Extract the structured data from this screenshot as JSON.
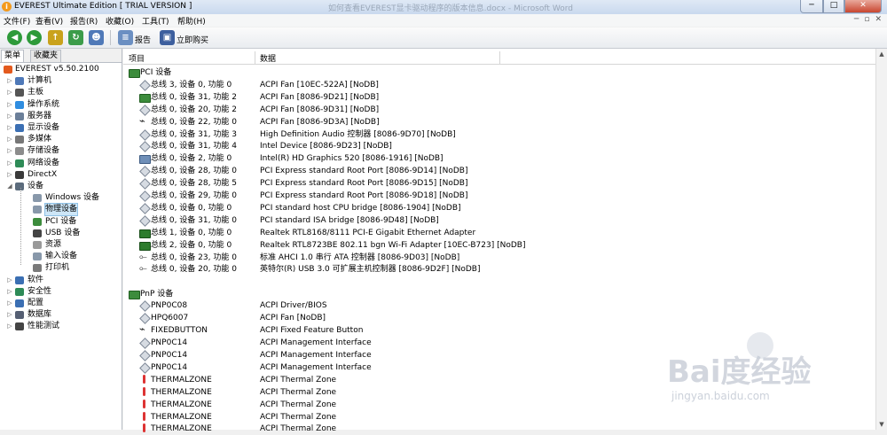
{
  "window": {
    "title": "EVEREST Ultimate Edition  [ TRIAL VERSION ]",
    "background_title": "如何查看EVEREST显卡驱动程序的版本信息.docx - Microsoft Word",
    "controls": {
      "minimize": "─",
      "maximize": "□",
      "close": "✕"
    }
  },
  "menu": {
    "items": [
      "文件(F)",
      "查看(V)",
      "报告(R)",
      "收藏(O)",
      "工具(T)",
      "帮助(H)"
    ],
    "mdi": [
      "─",
      "▫",
      "✕"
    ]
  },
  "toolbar": {
    "report_label": "报告",
    "buy_label": "立即购买"
  },
  "sidebar": {
    "tabs": [
      "菜单",
      "收藏夹"
    ],
    "items": [
      {
        "label": "EVEREST v5.50.2100",
        "level": 0,
        "arrow": "",
        "icon": "everest-icon",
        "color": "#e35a1e"
      },
      {
        "label": "计算机",
        "level": 1,
        "arrow": "▷",
        "icon": "computer-icon",
        "color": "#4f79b8"
      },
      {
        "label": "主板",
        "level": 1,
        "arrow": "▷",
        "icon": "motherboard-icon",
        "color": "#555555"
      },
      {
        "label": "操作系统",
        "level": 1,
        "arrow": "▷",
        "icon": "windows-icon",
        "color": "#2f8de0"
      },
      {
        "label": "服务器",
        "level": 1,
        "arrow": "▷",
        "icon": "server-icon",
        "color": "#6b7f99"
      },
      {
        "label": "显示设备",
        "level": 1,
        "arrow": "▷",
        "icon": "display-icon",
        "color": "#3b6fb3"
      },
      {
        "label": "多媒体",
        "level": 1,
        "arrow": "▷",
        "icon": "multimedia-icon",
        "color": "#777777"
      },
      {
        "label": "存储设备",
        "level": 1,
        "arrow": "▷",
        "icon": "storage-icon",
        "color": "#8c8c8c"
      },
      {
        "label": "网络设备",
        "level": 1,
        "arrow": "▷",
        "icon": "network-icon",
        "color": "#2e8b57"
      },
      {
        "label": "DirectX",
        "level": 1,
        "arrow": "▷",
        "icon": "directx-icon",
        "color": "#3a3a3a"
      },
      {
        "label": "设备",
        "level": 1,
        "arrow": "◢",
        "icon": "devices-icon",
        "color": "#5b6b7c"
      },
      {
        "label": "Windows 设备",
        "level": 2,
        "arrow": "",
        "icon": "windows-device-icon",
        "color": "#8898aa"
      },
      {
        "label": "物理设备",
        "level": 2,
        "arrow": "",
        "icon": "physical-device-icon",
        "color": "#8898aa"
      },
      {
        "label": "PCI 设备",
        "level": 2,
        "arrow": "",
        "icon": "pci-icon",
        "color": "#3c8c3c"
      },
      {
        "label": "USB 设备",
        "level": 2,
        "arrow": "",
        "icon": "usb-icon",
        "color": "#444444"
      },
      {
        "label": "资源",
        "level": 2,
        "arrow": "",
        "icon": "resources-icon",
        "color": "#9a9a9a"
      },
      {
        "label": "输入设备",
        "level": 2,
        "arrow": "",
        "icon": "input-icon",
        "color": "#8898aa"
      },
      {
        "label": "打印机",
        "level": 2,
        "arrow": "",
        "icon": "printer-icon",
        "color": "#7a7a7a"
      },
      {
        "label": "软件",
        "level": 1,
        "arrow": "▷",
        "icon": "software-icon",
        "color": "#3b6fb3"
      },
      {
        "label": "安全性",
        "level": 1,
        "arrow": "▷",
        "icon": "security-icon",
        "color": "#2e8b57"
      },
      {
        "label": "配置",
        "level": 1,
        "arrow": "▷",
        "icon": "config-icon",
        "color": "#3b6fb3"
      },
      {
        "label": "数据库",
        "level": 1,
        "arrow": "▷",
        "icon": "database-icon",
        "color": "#555f73"
      },
      {
        "label": "性能测试",
        "level": 1,
        "arrow": "▷",
        "icon": "benchmark-icon",
        "color": "#444444"
      }
    ],
    "selected_index": 12
  },
  "list": {
    "col_item": "项目",
    "col_data": "数据",
    "groups": [
      {
        "title": "PCI 设备",
        "rows": [
          {
            "name": "总线 3, 设备 0, 功能 0",
            "value": "ACPI Fan [10EC-522A] [NoDB]",
            "icon": "diamond"
          },
          {
            "name": "总线 0, 设备 31, 功能 2",
            "value": "ACPI Fan [8086-9D21] [NoDB]",
            "icon": "board"
          },
          {
            "name": "总线 0, 设备 20, 功能 2",
            "value": "ACPI Fan [8086-9D31] [NoDB]",
            "icon": "diamond"
          },
          {
            "name": "总线 0, 设备 22, 功能 0",
            "value": "ACPI Fan [8086-9D3A] [NoDB]",
            "icon": "key"
          },
          {
            "name": "总线 0, 设备 31, 功能 3",
            "value": "High Definition Audio 控制器 [8086-9D70] [NoDB]",
            "icon": "diamond"
          },
          {
            "name": "总线 0, 设备 31, 功能 4",
            "value": "Intel Device [8086-9D23] [NoDB]",
            "icon": "diamond"
          },
          {
            "name": "总线 0, 设备 2, 功能 0",
            "value": "Intel(R) HD Graphics 520 [8086-1916] [NoDB]",
            "icon": "gpu"
          },
          {
            "name": "总线 0, 设备 28, 功能 0",
            "value": "PCI Express standard Root Port [8086-9D14] [NoDB]",
            "icon": "diamond"
          },
          {
            "name": "总线 0, 设备 28, 功能 5",
            "value": "PCI Express standard Root Port [8086-9D15] [NoDB]",
            "icon": "diamond"
          },
          {
            "name": "总线 0, 设备 29, 功能 0",
            "value": "PCI Express standard Root Port [8086-9D18] [NoDB]",
            "icon": "diamond"
          },
          {
            "name": "总线 0, 设备 0, 功能 0",
            "value": "PCI standard host CPU bridge [8086-1904] [NoDB]",
            "icon": "diamond"
          },
          {
            "name": "总线 0, 设备 31, 功能 0",
            "value": "PCI standard ISA bridge [8086-9D48] [NoDB]",
            "icon": "diamond"
          },
          {
            "name": "总线 1, 设备 0, 功能 0",
            "value": "Realtek RTL8168/8111 PCI-E Gigabit Ethernet Adapter",
            "icon": "net"
          },
          {
            "name": "总线 2, 设备 0, 功能 0",
            "value": "Realtek RTL8723BE 802.11 bgn Wi-Fi Adapter [10EC-B723] [NoDB]",
            "icon": "net"
          },
          {
            "name": "总线 0, 设备 23, 功能 0",
            "value": "标准 AHCI 1.0 串行 ATA 控制器 [8086-9D03] [NoDB]",
            "icon": "usb"
          },
          {
            "name": "总线 0, 设备 20, 功能 0",
            "value": "英特尔(R) USB 3.0 可扩展主机控制器 [8086-9D2F] [NoDB]",
            "icon": "usb"
          }
        ]
      },
      {
        "title": "PnP 设备",
        "rows": [
          {
            "name": "PNP0C08",
            "value": "ACPI Driver/BIOS",
            "icon": "diamond"
          },
          {
            "name": "HPQ6007",
            "value": "ACPI Fan [NoDB]",
            "icon": "diamond"
          },
          {
            "name": "FIXEDBUTTON",
            "value": "ACPI Fixed Feature Button",
            "icon": "key"
          },
          {
            "name": "PNP0C14",
            "value": "ACPI Management Interface",
            "icon": "diamond"
          },
          {
            "name": "PNP0C14",
            "value": "ACPI Management Interface",
            "icon": "diamond"
          },
          {
            "name": "PNP0C14",
            "value": "ACPI Management Interface",
            "icon": "diamond"
          },
          {
            "name": "THERMALZONE",
            "value": "ACPI Thermal Zone",
            "icon": "therm"
          },
          {
            "name": "THERMALZONE",
            "value": "ACPI Thermal Zone",
            "icon": "therm"
          },
          {
            "name": "THERMALZONE",
            "value": "ACPI Thermal Zone",
            "icon": "therm"
          },
          {
            "name": "THERMALZONE",
            "value": "ACPI Thermal Zone",
            "icon": "therm"
          },
          {
            "name": "THERMALZONE",
            "value": "ACPI Thermal Zone",
            "icon": "therm"
          }
        ]
      }
    ]
  },
  "watermark": {
    "brand": "Bai度经验",
    "url": "jingyan.baidu.com"
  }
}
